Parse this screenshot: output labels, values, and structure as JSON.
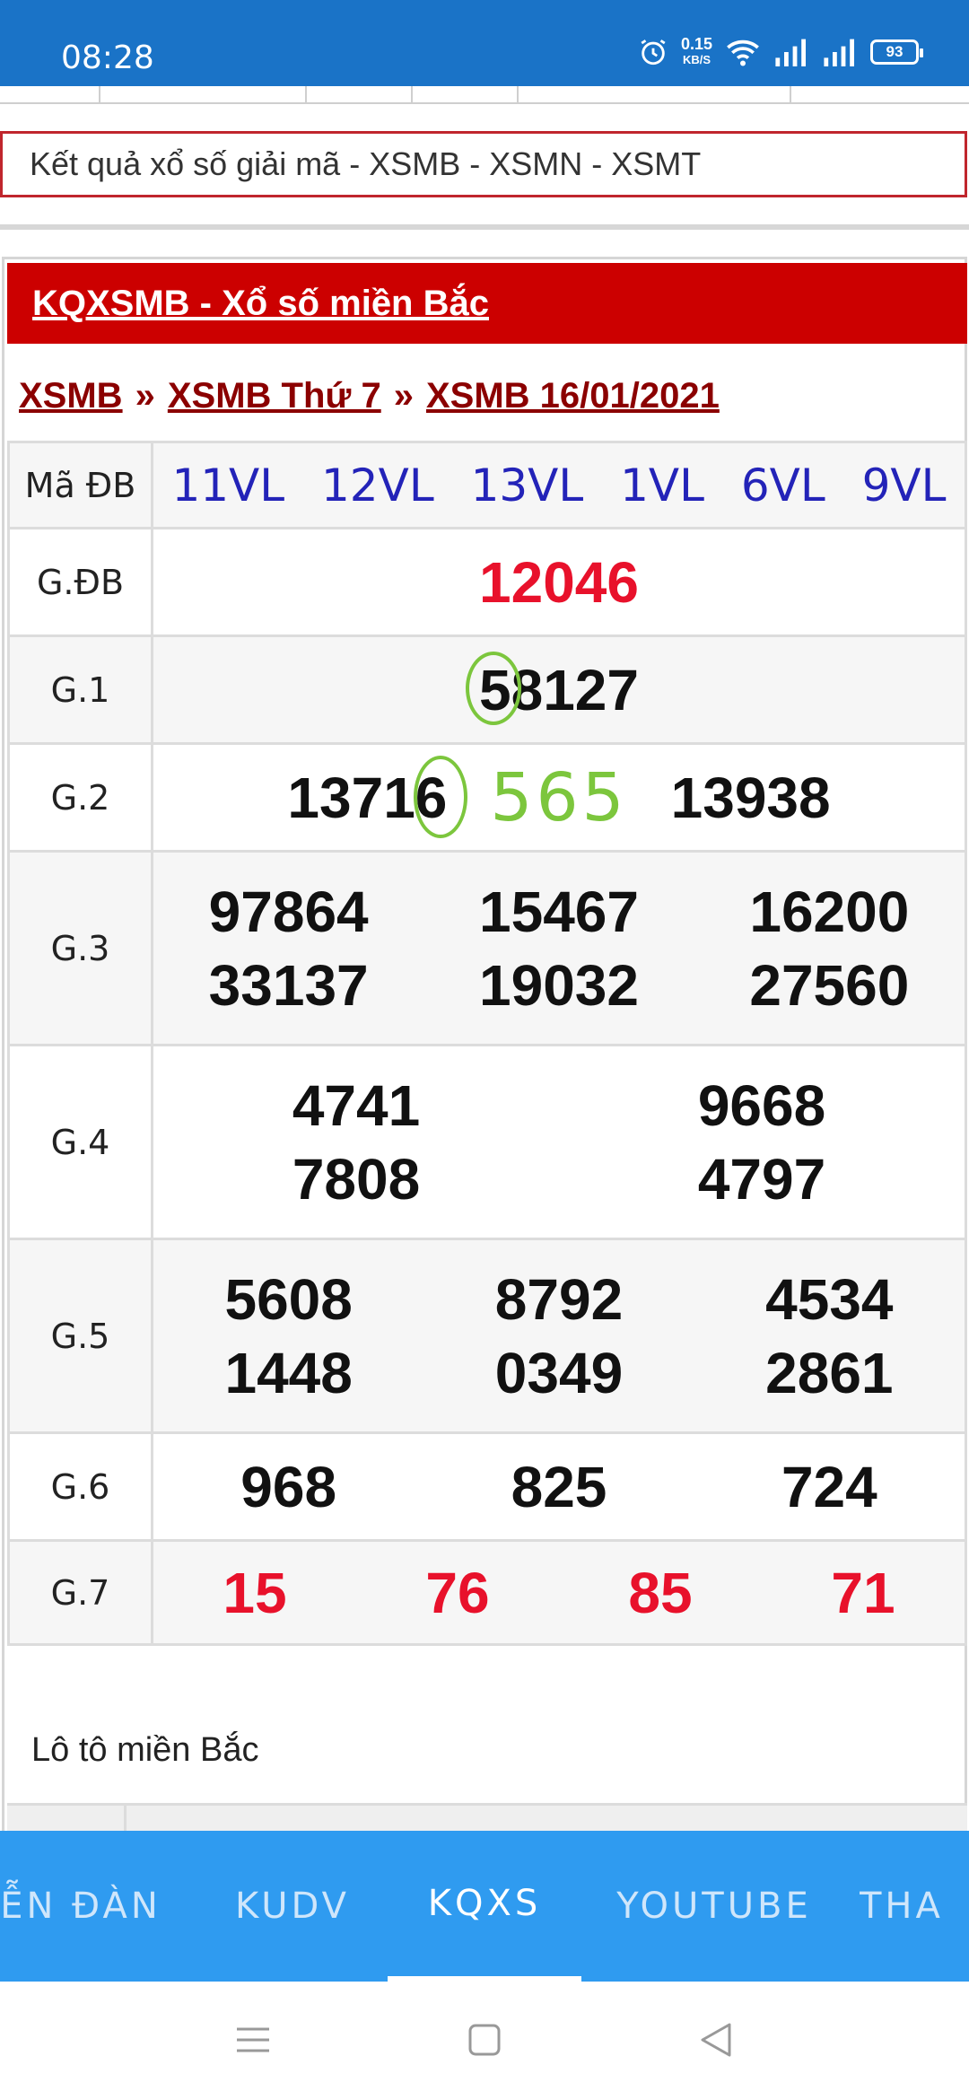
{
  "status": {
    "time": "08:28",
    "speed_value": "0.15",
    "speed_unit": "KB/S",
    "battery": "93"
  },
  "titlebar": {
    "text": "Kết quả xổ số giải mã - XSMB - XSMN - XSMT"
  },
  "card": {
    "heading": "KQXSMB - Xổ số miền Bắc",
    "breadcrumbs": [
      "XSMB",
      "XSMB Thứ 7",
      "XSMB 16/01/2021"
    ],
    "separator": "»"
  },
  "results": {
    "code_label": "Mã ĐB",
    "codes": [
      "11VL",
      "12VL",
      "13VL",
      "1VL",
      "6VL",
      "9VL"
    ],
    "labels": [
      "G.ĐB",
      "G.1",
      "G.2",
      "G.3",
      "G.4",
      "G.5",
      "G.6",
      "G.7"
    ],
    "gdb": "12046",
    "g1": "58127",
    "g2": [
      "13716",
      "13938"
    ],
    "g2_note": "565",
    "g3": [
      "97864",
      "15467",
      "16200",
      "33137",
      "19032",
      "27560"
    ],
    "g4": [
      "4741",
      "9668",
      "7808",
      "4797"
    ],
    "g5": [
      "5608",
      "8792",
      "4534",
      "1448",
      "0349",
      "2861"
    ],
    "g6": [
      "968",
      "825",
      "724"
    ],
    "g7": [
      "15",
      "76",
      "85",
      "71"
    ]
  },
  "loto": {
    "title": "Lô tô miền Bắc"
  },
  "tabs": [
    "ỄN ĐÀN",
    "KUDV",
    "KQXS",
    "YOUTUBE",
    "THA"
  ],
  "active_tab": "KQXS",
  "colors": {
    "status_bar": "#1a73c7",
    "header_red": "#cc0000",
    "prize_red": "#e8112b",
    "code_blue": "#2323b8",
    "tab_bar": "#2f9bf0",
    "annotation_green": "#7cc63d"
  }
}
